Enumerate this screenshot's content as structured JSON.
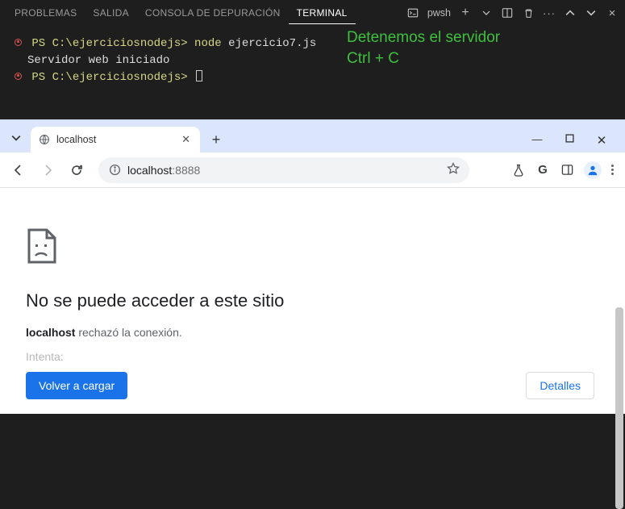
{
  "panel": {
    "tabs": [
      "PROBLEMAS",
      "SALIDA",
      "CONSOLA DE DEPURACIÓN",
      "TERMINAL"
    ],
    "activeTab": "TERMINAL",
    "shell": "pwsh"
  },
  "terminal": {
    "line1_prompt": "PS C:\\ejerciciosnodejs>",
    "line1_cmd": "node",
    "line1_arg": "ejercicio7.js",
    "line2": "Servidor web iniciado",
    "line3_prompt": "PS C:\\ejerciciosnodejs>"
  },
  "annotation": {
    "l1": "Detenemos el servidor",
    "l2": "Ctrl + C"
  },
  "browser": {
    "tabTitle": "localhost",
    "url_host": "localhost",
    "url_port": ":8888"
  },
  "errorPage": {
    "title": "No se puede acceder a este sitio",
    "host": "localhost",
    "sub_rest": " rechazó la conexión.",
    "suggest": "Intenta:",
    "reload": "Volver a cargar",
    "details": "Detalles"
  }
}
